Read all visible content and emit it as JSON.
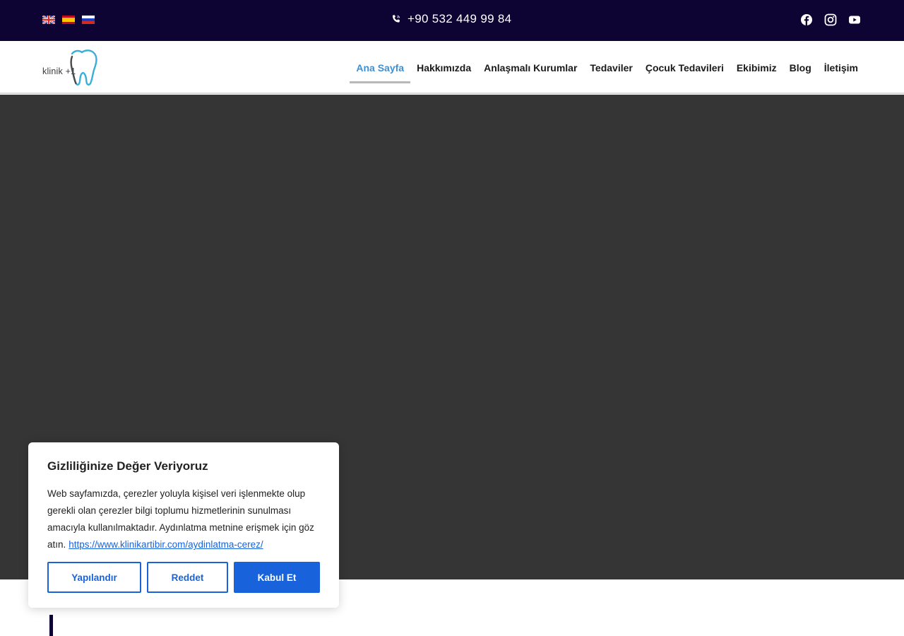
{
  "topbar": {
    "languages": [
      {
        "icon": "uk-flag-icon",
        "code": "en"
      },
      {
        "icon": "spain-flag-icon",
        "code": "es"
      },
      {
        "icon": "russia-flag-icon",
        "code": "ru"
      }
    ],
    "phone_icon": "phone-icon",
    "phone": "+90 532 449 99 84",
    "socials": [
      "facebook-icon",
      "instagram-icon",
      "youtube-icon"
    ],
    "background": "#0e0433"
  },
  "header": {
    "logo_text": "klinik +1",
    "nav": [
      {
        "label": "Ana Sayfa",
        "active": true
      },
      {
        "label": "Hakkımızda",
        "active": false
      },
      {
        "label": "Anlaşmalı Kurumlar",
        "active": false
      },
      {
        "label": "Tedaviler",
        "active": false
      },
      {
        "label": "Çocuk Tedavileri",
        "active": false
      },
      {
        "label": "Ekibimiz",
        "active": false
      },
      {
        "label": "Blog",
        "active": false
      },
      {
        "label": "İletişim",
        "active": false
      }
    ],
    "active_color": "#3f90d1"
  },
  "cookie": {
    "title": "Gizliliğinize Değer Veriyoruz",
    "body": "Web sayfamızda, çerezler yoluyla kişisel veri işlenmekte olup gerekli olan çerezler bilgi toplumu hizmetlerinin sunulması amacıyla kullanılmaktadır. Aydınlatma metnine erişmek için göz atın.",
    "link": "https://www.klinikartibir.com/aydinlatma-cerez/",
    "buttons": {
      "configure": "Yapılandır",
      "reject": "Reddet",
      "accept": "Kabul Et"
    },
    "accent_color": "#1863dc"
  }
}
